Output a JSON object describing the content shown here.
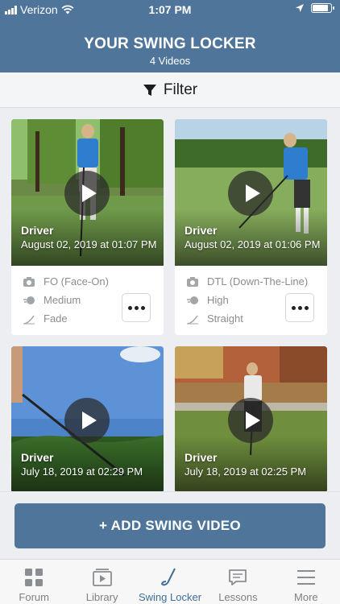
{
  "status_bar": {
    "carrier": "Verizon",
    "time": "1:07 PM"
  },
  "header": {
    "title": "YOUR SWING LOCKER",
    "subtitle": "4 Videos"
  },
  "filter": {
    "label": "Filter"
  },
  "videos": [
    {
      "club": "Driver",
      "date": "August 02, 2019 at 01:07 PM",
      "view": "FO (Face-On)",
      "speed": "Medium",
      "shot": "Fade"
    },
    {
      "club": "Driver",
      "date": "August 02, 2019 at 01:06 PM",
      "view": "DTL (Down-The-Line)",
      "speed": "High",
      "shot": "Straight"
    },
    {
      "club": "Driver",
      "date": "July 18, 2019 at 02:29 PM"
    },
    {
      "club": "Driver",
      "date": "July 18, 2019 at 02:25 PM"
    }
  ],
  "add_button": {
    "label": "+ ADD SWING VIDEO"
  },
  "tabs": [
    {
      "label": "Forum",
      "icon": "grid-icon",
      "active": false
    },
    {
      "label": "Library",
      "icon": "library-icon",
      "active": false
    },
    {
      "label": "Swing Locker",
      "icon": "golf-club-icon",
      "active": true
    },
    {
      "label": "Lessons",
      "icon": "chat-icon",
      "active": false
    },
    {
      "label": "More",
      "icon": "menu-icon",
      "active": false
    }
  ],
  "colors": {
    "brand": "#4f769a",
    "active_tab": "#3e6f98"
  }
}
